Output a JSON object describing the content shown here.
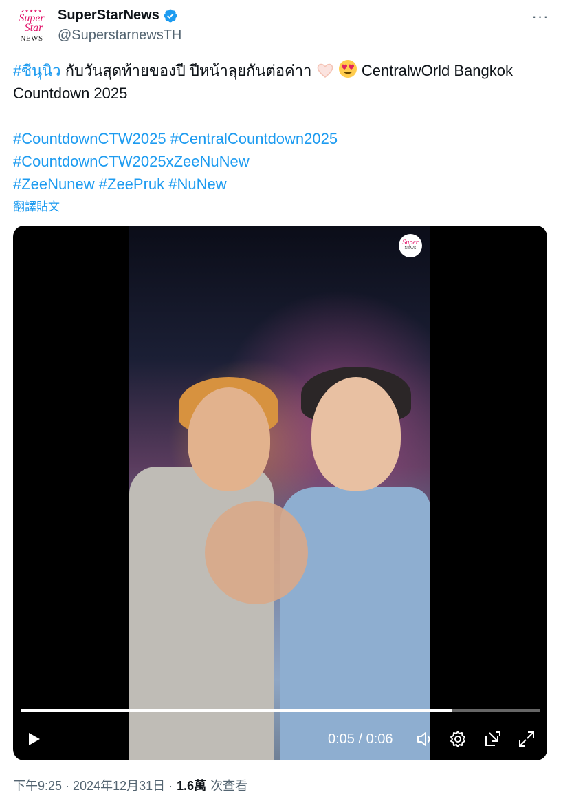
{
  "author": {
    "display_name": "SuperStarNews",
    "handle": "@SuperstarnewsTH",
    "verified": true,
    "avatar_text": [
      "Super",
      "Star",
      "NEWS"
    ]
  },
  "more_icon": "more-horizontal-icon",
  "tweet": {
    "line1": {
      "hashtag": "#ซีนุนิว",
      "text": "กับวันสุดท้ายของปี ปีหน้าลุยกันต่อค่าา",
      "emojis": [
        "heart-hands-emoji",
        "heart-eyes-emoji"
      ],
      "text_after": "CentralwOrld Bangkok"
    },
    "line2": "Countdown 2025",
    "hashtags_line1": [
      "#CountdownCTW2025",
      "#CentralCountdown2025"
    ],
    "hashtags_line2": [
      "#CountdownCTW2025xZeeNuNew"
    ],
    "hashtags_line3": [
      "#ZeeNunew",
      "#ZeePruk",
      "#NuNew"
    ]
  },
  "translate_label": "翻譯貼文",
  "video": {
    "time_display": "0:05 / 0:06",
    "progress_fraction": 0.83,
    "watermark": [
      "Super",
      "NEWS"
    ]
  },
  "footer": {
    "timestamp": "下午9:25 · 2024年12月31日 ·",
    "views_count": "1.6萬",
    "views_label": "次查看"
  },
  "colors": {
    "link": "#1d9bf0",
    "secondary_text": "#536471",
    "brand_pink": "#e2156b"
  }
}
